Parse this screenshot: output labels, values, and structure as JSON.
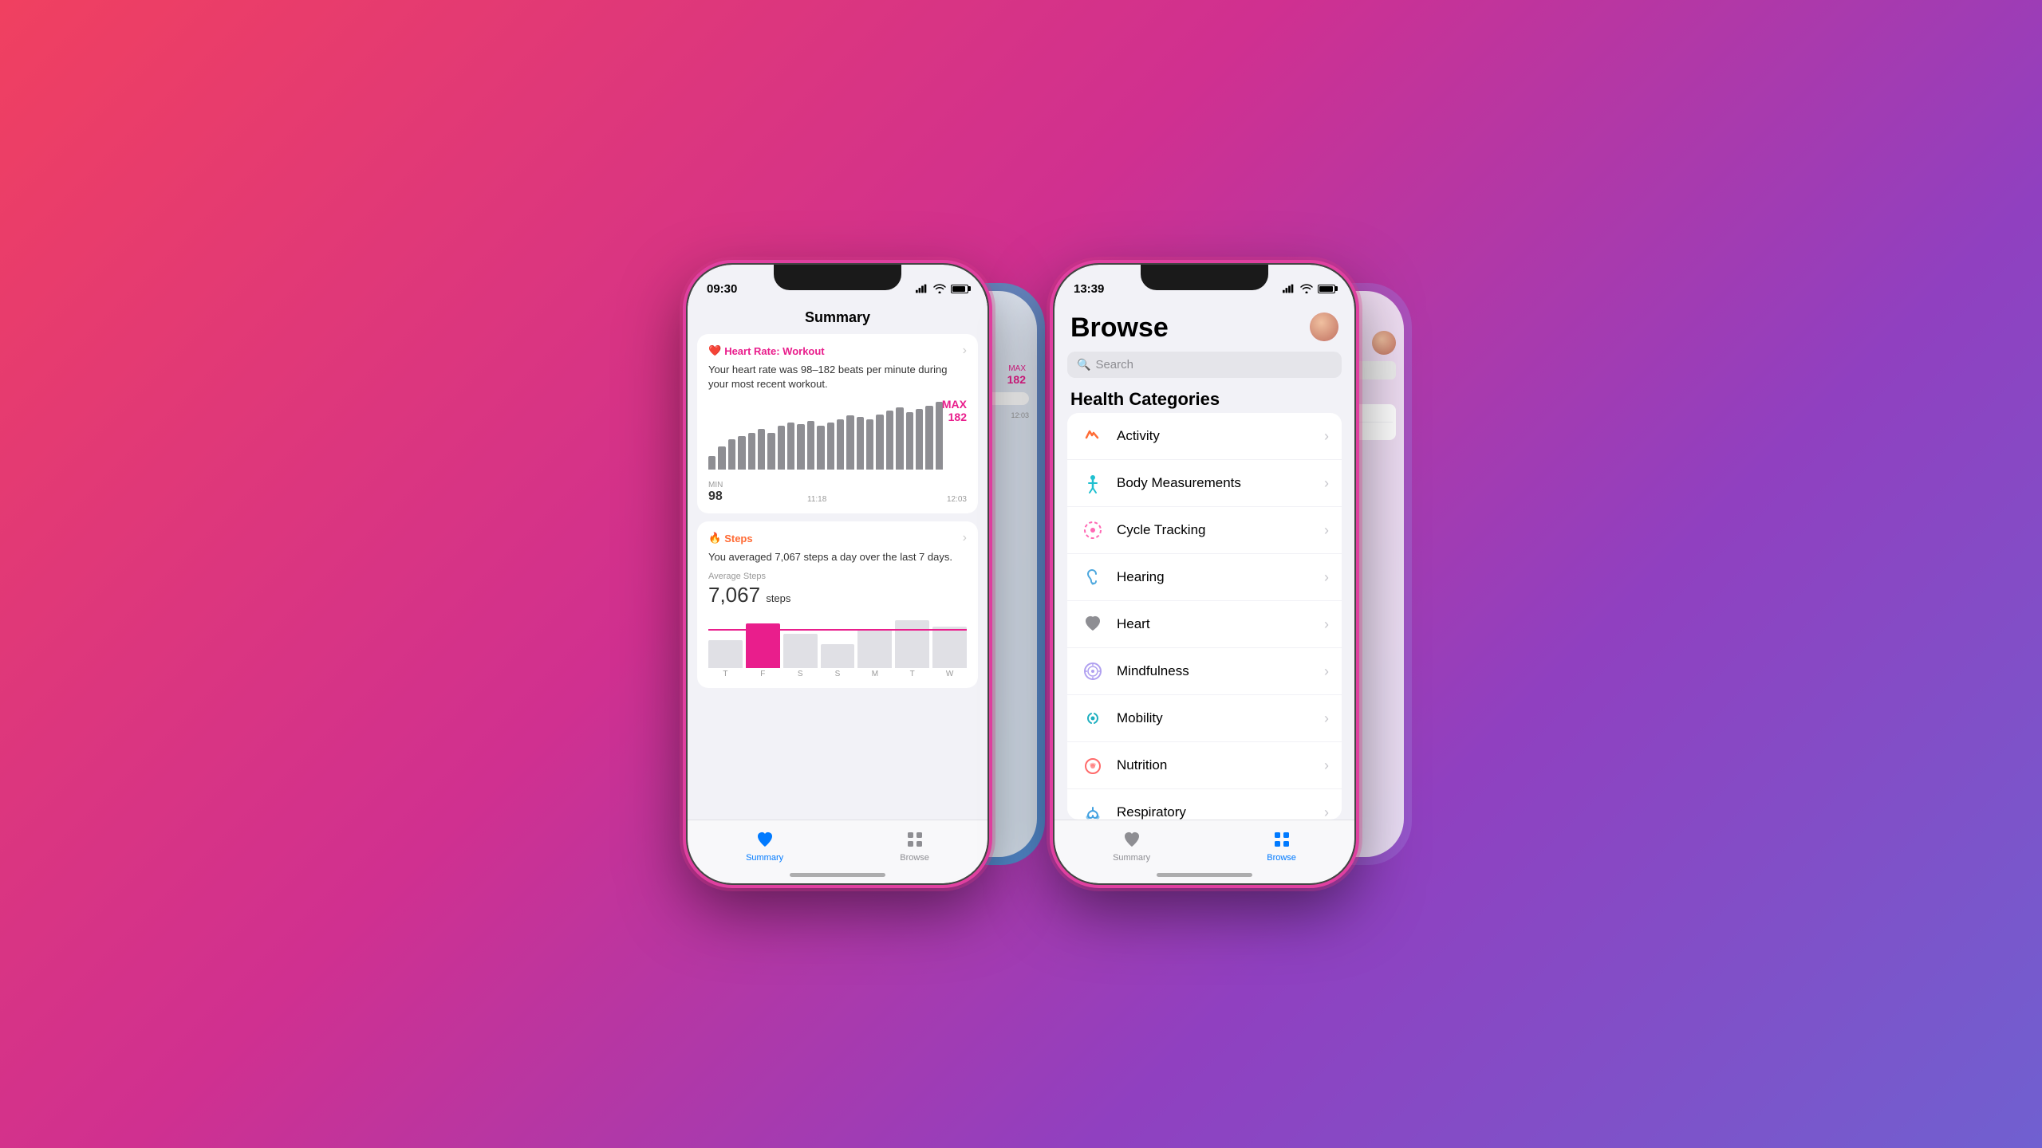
{
  "background": {
    "gradient": "135deg, #f04060, #d03090, #9040c0, #7060d0"
  },
  "left_phone": {
    "status_bar": {
      "time": "09:30",
      "signal": true,
      "wifi": true,
      "battery": true
    },
    "screen": "summary",
    "header": "Summary",
    "cards": [
      {
        "id": "heart_rate",
        "title": "Heart Rate: Workout",
        "icon": "heart",
        "description": "Your heart rate was 98–182 beats per minute during your most recent workout.",
        "chart_type": "bar",
        "min_label": "MIN",
        "min_value": "98",
        "max_label": "MAX",
        "max_value": "182",
        "time_start": "11:18",
        "time_end": "12:03",
        "bars": [
          20,
          35,
          45,
          50,
          55,
          60,
          55,
          65,
          70,
          68,
          72,
          65,
          70,
          75,
          80,
          78,
          75,
          82,
          88,
          92,
          85,
          90,
          95,
          100
        ]
      },
      {
        "id": "steps",
        "title": "Steps",
        "icon": "flame",
        "description": "You averaged 7,067 steps a day over the last 7 days.",
        "chart_type": "steps_bar",
        "avg_label": "Average Steps",
        "avg_value": "7,067",
        "avg_unit": "steps",
        "days": [
          "T",
          "F",
          "S",
          "S",
          "M",
          "T",
          "W"
        ],
        "step_bars": [
          40,
          65,
          50,
          35,
          55,
          70,
          60
        ]
      }
    ],
    "tabs": [
      {
        "id": "summary",
        "label": "Summary",
        "active": true
      },
      {
        "id": "browse",
        "label": "Browse",
        "active": false
      }
    ]
  },
  "right_phone": {
    "status_bar": {
      "time": "13:39",
      "signal": true,
      "wifi": true,
      "battery": true
    },
    "screen": "browse",
    "header": "Browse",
    "search_placeholder": "Search",
    "categories_title": "Health Categories",
    "categories": [
      {
        "id": "activity",
        "label": "Activity",
        "icon": "flame",
        "color": "#ff6b35"
      },
      {
        "id": "body_measurements",
        "label": "Body Measurements",
        "icon": "figure",
        "color": "#20c0d0"
      },
      {
        "id": "cycle_tracking",
        "label": "Cycle Tracking",
        "icon": "cycle",
        "color": "#ff69b4"
      },
      {
        "id": "hearing",
        "label": "Hearing",
        "icon": "ear",
        "color": "#4ea8de"
      },
      {
        "id": "heart",
        "label": "Heart",
        "icon": "heart",
        "color": "#8e8e93"
      },
      {
        "id": "mindfulness",
        "label": "Mindfulness",
        "icon": "mindfulness",
        "color": "#b0a0f0"
      },
      {
        "id": "mobility",
        "label": "Mobility",
        "icon": "mobility",
        "color": "#20b0c0"
      },
      {
        "id": "nutrition",
        "label": "Nutrition",
        "icon": "nutrition",
        "color": "#ff6b6b"
      },
      {
        "id": "respiratory",
        "label": "Respiratory",
        "icon": "lungs",
        "color": "#40a0e0"
      }
    ],
    "tabs": [
      {
        "id": "summary",
        "label": "Summary",
        "active": false
      },
      {
        "id": "browse",
        "label": "Browse",
        "active": true
      }
    ]
  }
}
